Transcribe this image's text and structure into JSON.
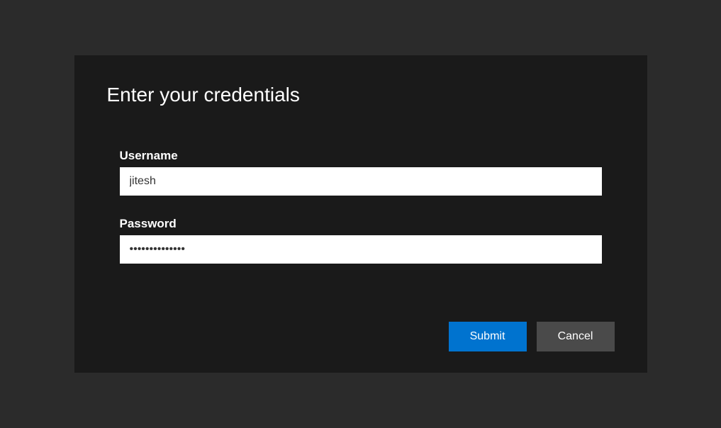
{
  "dialog": {
    "title": "Enter your credentials",
    "username_label": "Username",
    "username_value": "jitesh",
    "password_label": "Password",
    "password_value": "••••••••••••••",
    "submit_label": "Submit",
    "cancel_label": "Cancel"
  }
}
